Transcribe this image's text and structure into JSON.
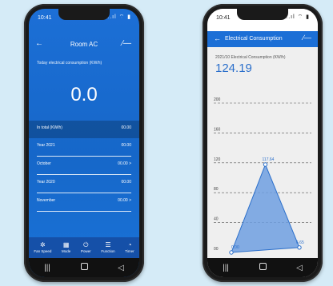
{
  "left_phone": {
    "status_time": "10:41",
    "status_icons": "..ıl ⌔ ▮",
    "back_icon": "back-arrow-icon",
    "title": "Room AC",
    "edit_icon": "edit-pen-icon",
    "today_label": "Today electrical consumption (KW/h)",
    "today_value": "0.0",
    "rows": [
      {
        "label": "In total (KW/h)",
        "value": "00.00"
      },
      {
        "label": "Year 2021",
        "value": "00.00"
      },
      {
        "label": "October",
        "value": "00.00 >"
      },
      {
        "label": "Year 2020",
        "value": "00.00"
      },
      {
        "label": "November",
        "value": "00.00 >"
      }
    ],
    "page_dots": "• •",
    "bottom_bar": [
      {
        "icon": "fan-icon",
        "glyph": "✲",
        "label": "Fan Speed"
      },
      {
        "icon": "mode-icon",
        "glyph": "▦",
        "label": "Mode"
      },
      {
        "icon": "power-icon",
        "glyph": "⏻",
        "label": "Power"
      },
      {
        "icon": "function-icon",
        "glyph": "☰",
        "label": "Function"
      },
      {
        "icon": "timer-icon",
        "glyph": "◔",
        "label": "Timer"
      }
    ]
  },
  "right_phone": {
    "status_time": "10:41",
    "status_icons": "..ıl ⌔ ▮",
    "title": "Electrical Consumption",
    "sub_label": "2021/10 Electrical Consumption (KW/h)",
    "total_value": "124.19"
  },
  "nav_bar": {
    "back": "◁",
    "home": "",
    "recents": "|||"
  },
  "chart_data": {
    "type": "area",
    "yticks": [
      "200",
      "160",
      "120",
      "80",
      "40",
      "00"
    ],
    "ylim": [
      0,
      200
    ],
    "x": [
      0,
      1,
      2
    ],
    "values": [
      0.0,
      117.64,
      6.65
    ],
    "data_labels": [
      "0.00",
      "117.64",
      "6.65"
    ],
    "grid": true,
    "line_color": "#2b6fcb",
    "fill_color": "#6e9fe0"
  }
}
